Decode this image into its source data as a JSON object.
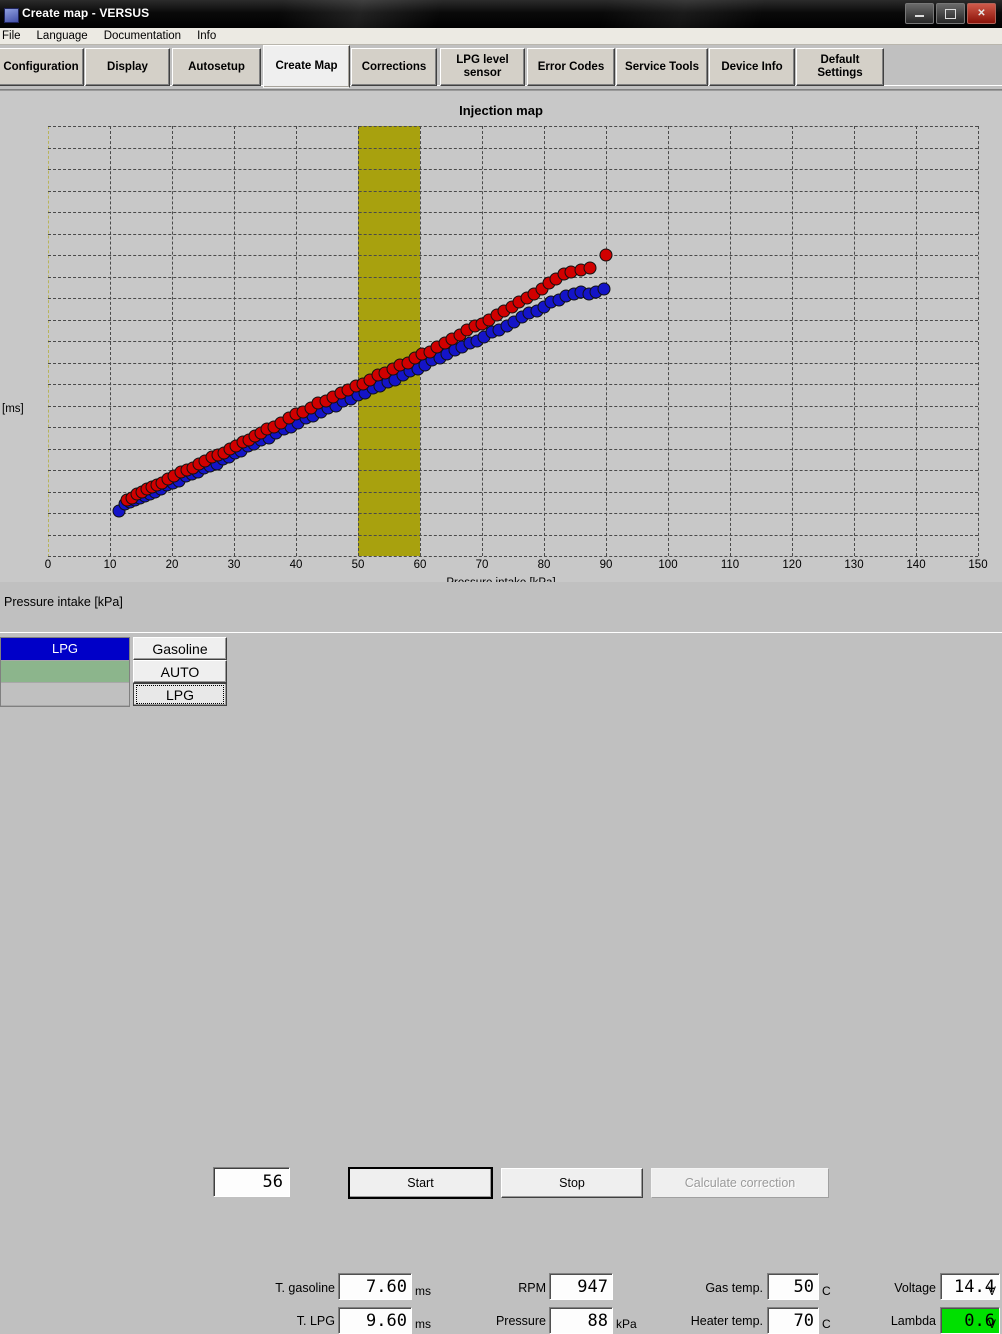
{
  "window": {
    "title": "Create map - VERSUS",
    "icon": "app-icon",
    "minimize": "–",
    "maximize": "□",
    "close": "✕"
  },
  "menu": [
    "File",
    "Language",
    "Documentation",
    "Info"
  ],
  "tabs": [
    {
      "label": "Configuration",
      "active": false
    },
    {
      "label": "Display",
      "active": false
    },
    {
      "label": "Autosetup",
      "active": false
    },
    {
      "label": "Create Map",
      "active": true
    },
    {
      "label": "Corrections",
      "active": false
    },
    {
      "label": "LPG level sensor",
      "active": false
    },
    {
      "label": "Error Codes",
      "active": false
    },
    {
      "label": "Service Tools",
      "active": false
    },
    {
      "label": "Device Info",
      "active": false
    },
    {
      "label": "Default Settings",
      "active": false
    }
  ],
  "controls": {
    "pressure_label": "Pressure intake [kPa]",
    "pressure_value": "56",
    "start_label": "Start",
    "stop_label": "Stop",
    "calc_label": "Calculate correction"
  },
  "status": {
    "fuel_rows": [
      "LPG",
      "",
      ""
    ],
    "mode_buttons": [
      "Gasoline",
      "AUTO",
      "LPG"
    ],
    "mode_selected": "LPG",
    "readouts": [
      {
        "label": "T. gasoline",
        "value": "7.60",
        "unit": "ms"
      },
      {
        "label": "T. LPG",
        "value": "9.60",
        "unit": "ms"
      },
      {
        "label": "RPM",
        "value": "947",
        "unit": ""
      },
      {
        "label": "Pressure",
        "value": "88",
        "unit": "kPa"
      },
      {
        "label": "Gas temp.",
        "value": "50",
        "unit": "C"
      },
      {
        "label": "Heater temp.",
        "value": "70",
        "unit": "C"
      },
      {
        "label": "Voltage",
        "value": "14.4",
        "unit": "V"
      },
      {
        "label": "Lambda",
        "value": "0.6",
        "unit": "V"
      }
    ]
  },
  "colors": {
    "gasoline_series": "#d10000",
    "lpg_series": "#1414c8",
    "highlight_band": "#a8a10e",
    "lambda_ok": "#00e000",
    "lpg_active": "#0000c8"
  },
  "chart_data": {
    "type": "scatter",
    "title": "Injection map",
    "xlabel": "Pressure intake [kPa]",
    "ylabel": "[ms]",
    "xlim": [
      0,
      150
    ],
    "ylim": [
      0,
      20
    ],
    "xticks": [
      0,
      10,
      20,
      30,
      40,
      50,
      60,
      70,
      80,
      90,
      100,
      110,
      120,
      130,
      140,
      150
    ],
    "yticks": [
      0,
      1,
      2,
      3,
      4,
      5,
      6,
      7,
      8,
      9,
      10,
      11,
      12,
      13,
      14,
      15,
      16,
      17,
      18,
      19,
      20
    ],
    "grid": true,
    "legend": "none",
    "highlight_band": {
      "x_start": 50,
      "x_end": 60,
      "color": "#a8a10e"
    },
    "series": [
      {
        "name": "Gasoline",
        "color": "#d10000",
        "points": [
          [
            12.8,
            2.6
          ],
          [
            13.6,
            2.7
          ],
          [
            14.4,
            2.9
          ],
          [
            15.2,
            3.0
          ],
          [
            16.0,
            3.1
          ],
          [
            16.8,
            3.2
          ],
          [
            17.6,
            3.3
          ],
          [
            18.4,
            3.4
          ],
          [
            19.4,
            3.6
          ],
          [
            20.4,
            3.7
          ],
          [
            21.4,
            3.9
          ],
          [
            22.4,
            4.0
          ],
          [
            23.4,
            4.1
          ],
          [
            24.4,
            4.3
          ],
          [
            25.4,
            4.4
          ],
          [
            26.4,
            4.6
          ],
          [
            27.4,
            4.7
          ],
          [
            28.4,
            4.8
          ],
          [
            29.4,
            5.0
          ],
          [
            30.4,
            5.1
          ],
          [
            31.4,
            5.3
          ],
          [
            32.4,
            5.4
          ],
          [
            33.4,
            5.6
          ],
          [
            34.4,
            5.7
          ],
          [
            35.4,
            5.9
          ],
          [
            36.4,
            6.0
          ],
          [
            37.6,
            6.2
          ],
          [
            38.8,
            6.4
          ],
          [
            40.0,
            6.6
          ],
          [
            41.2,
            6.7
          ],
          [
            42.4,
            6.9
          ],
          [
            43.6,
            7.1
          ],
          [
            44.8,
            7.2
          ],
          [
            46.0,
            7.4
          ],
          [
            47.2,
            7.6
          ],
          [
            48.4,
            7.7
          ],
          [
            49.6,
            7.9
          ],
          [
            50.8,
            8.0
          ],
          [
            52.0,
            8.2
          ],
          [
            53.2,
            8.4
          ],
          [
            54.4,
            8.5
          ],
          [
            55.6,
            8.7
          ],
          [
            56.8,
            8.9
          ],
          [
            58.0,
            9.0
          ],
          [
            59.2,
            9.2
          ],
          [
            60.4,
            9.4
          ],
          [
            61.6,
            9.5
          ],
          [
            62.8,
            9.7
          ],
          [
            64.0,
            9.9
          ],
          [
            65.2,
            10.1
          ],
          [
            66.4,
            10.3
          ],
          [
            67.6,
            10.5
          ],
          [
            68.8,
            10.7
          ],
          [
            70.0,
            10.8
          ],
          [
            71.2,
            11.0
          ],
          [
            72.4,
            11.2
          ],
          [
            73.6,
            11.4
          ],
          [
            74.8,
            11.6
          ],
          [
            76.0,
            11.8
          ],
          [
            77.2,
            12.0
          ],
          [
            78.4,
            12.2
          ],
          [
            79.6,
            12.4
          ],
          [
            80.8,
            12.7
          ],
          [
            82.0,
            12.9
          ],
          [
            83.2,
            13.1
          ],
          [
            84.4,
            13.2
          ],
          [
            86.0,
            13.3
          ],
          [
            87.4,
            13.4
          ],
          [
            90.0,
            14.0
          ]
        ]
      },
      {
        "name": "LPG",
        "color": "#1414c8",
        "points": [
          [
            11.4,
            2.1
          ],
          [
            12.4,
            2.4
          ],
          [
            13.2,
            2.5
          ],
          [
            14.0,
            2.6
          ],
          [
            14.8,
            2.7
          ],
          [
            15.6,
            2.8
          ],
          [
            16.4,
            2.9
          ],
          [
            17.2,
            3.0
          ],
          [
            18.2,
            3.1
          ],
          [
            19.2,
            3.3
          ],
          [
            20.2,
            3.4
          ],
          [
            21.2,
            3.5
          ],
          [
            22.2,
            3.7
          ],
          [
            23.2,
            3.8
          ],
          [
            24.2,
            3.9
          ],
          [
            25.2,
            4.1
          ],
          [
            26.2,
            4.2
          ],
          [
            27.2,
            4.3
          ],
          [
            28.2,
            4.5
          ],
          [
            29.2,
            4.6
          ],
          [
            30.2,
            4.8
          ],
          [
            31.2,
            4.9
          ],
          [
            32.2,
            5.1
          ],
          [
            33.2,
            5.2
          ],
          [
            34.4,
            5.4
          ],
          [
            35.6,
            5.5
          ],
          [
            36.8,
            5.7
          ],
          [
            38.0,
            5.9
          ],
          [
            39.2,
            6.0
          ],
          [
            40.4,
            6.2
          ],
          [
            41.6,
            6.4
          ],
          [
            42.8,
            6.5
          ],
          [
            44.0,
            6.7
          ],
          [
            45.2,
            6.9
          ],
          [
            46.4,
            7.0
          ],
          [
            47.6,
            7.2
          ],
          [
            48.8,
            7.3
          ],
          [
            50.0,
            7.5
          ],
          [
            51.2,
            7.6
          ],
          [
            52.4,
            7.8
          ],
          [
            53.6,
            7.9
          ],
          [
            54.8,
            8.1
          ],
          [
            56.0,
            8.2
          ],
          [
            57.2,
            8.4
          ],
          [
            58.4,
            8.6
          ],
          [
            59.6,
            8.7
          ],
          [
            60.8,
            8.9
          ],
          [
            62.0,
            9.1
          ],
          [
            63.2,
            9.2
          ],
          [
            64.4,
            9.4
          ],
          [
            65.6,
            9.6
          ],
          [
            66.8,
            9.7
          ],
          [
            68.0,
            9.9
          ],
          [
            69.2,
            10.0
          ],
          [
            70.4,
            10.2
          ],
          [
            71.6,
            10.4
          ],
          [
            72.8,
            10.5
          ],
          [
            74.0,
            10.7
          ],
          [
            75.2,
            10.9
          ],
          [
            76.4,
            11.1
          ],
          [
            77.6,
            11.3
          ],
          [
            78.8,
            11.4
          ],
          [
            80.0,
            11.6
          ],
          [
            81.2,
            11.8
          ],
          [
            82.4,
            11.9
          ],
          [
            83.6,
            12.1
          ],
          [
            84.8,
            12.2
          ],
          [
            86.0,
            12.3
          ],
          [
            87.2,
            12.2
          ],
          [
            88.4,
            12.3
          ],
          [
            89.6,
            12.4
          ]
        ]
      }
    ]
  }
}
